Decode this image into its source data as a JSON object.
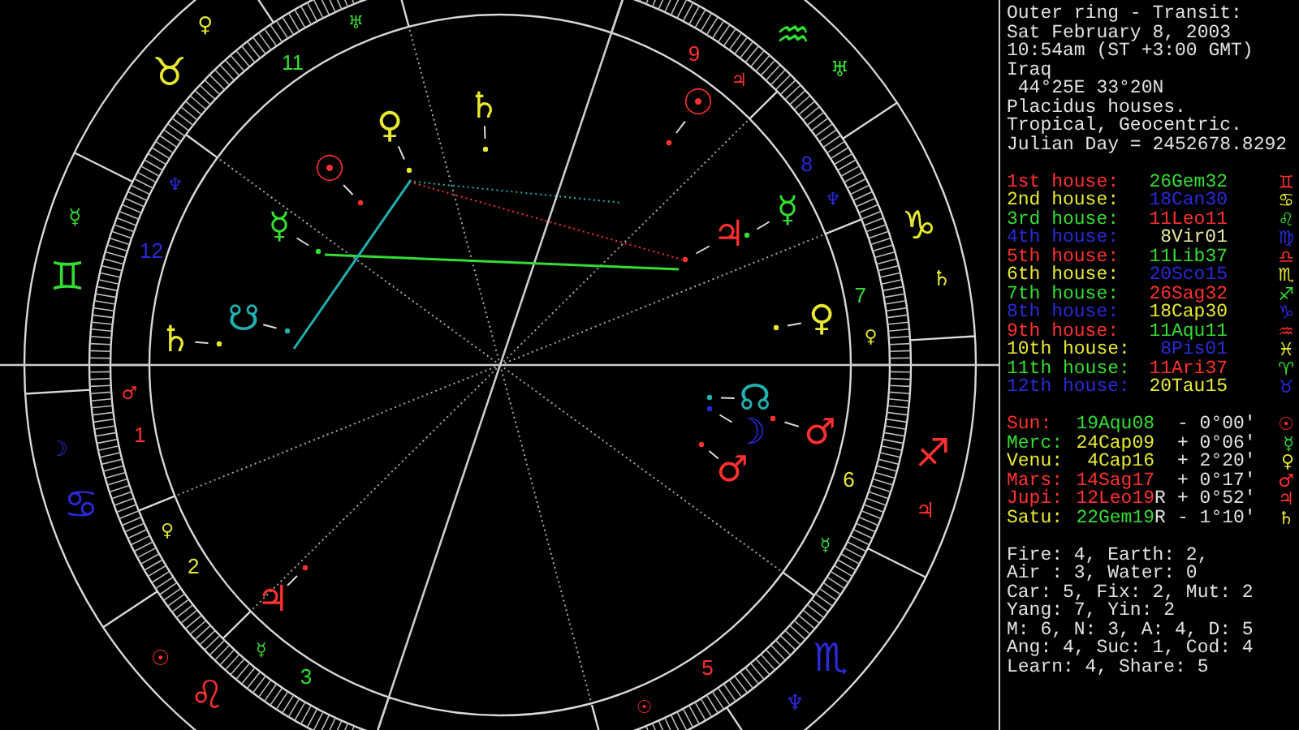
{
  "chart": {
    "signs": [
      {
        "glyph": "♉",
        "color": "#e8e830",
        "ruler": {
          "glyph": "♀",
          "color": "#e8e830"
        }
      },
      {
        "glyph": "♒",
        "color": "#33dd33",
        "ruler": {
          "glyph": "♅",
          "color": "#33dd33"
        }
      },
      {
        "glyph": "♊",
        "color": "#33dd33",
        "ruler": {
          "glyph": "☿",
          "color": "#33dd33"
        }
      },
      {
        "glyph": "♑",
        "color": "#e8e830",
        "ruler": {
          "glyph": "♄",
          "color": "#e8e830"
        }
      },
      {
        "glyph": "♐",
        "color": "#ff3030",
        "ruler": {
          "glyph": "♃",
          "color": "#ff3030"
        }
      },
      {
        "glyph": "♋",
        "color": "#2a2ad8",
        "ruler": {
          "glyph": "☽",
          "color": "#2a2ad8"
        }
      },
      {
        "glyph": "♌",
        "color": "#ff3030",
        "ruler": {
          "glyph": "☉",
          "color": "#ff3030"
        }
      },
      {
        "glyph": "♏",
        "color": "#2a2ad8",
        "ruler": {
          "glyph": "♆",
          "color": "#2a2ad8"
        }
      }
    ],
    "houses": [
      {
        "number": "11",
        "color": "#33dd33",
        "ruler": {
          "glyph": "♅",
          "color": "#33dd33"
        }
      },
      {
        "number": "9",
        "color": "#ff3030",
        "ruler": {
          "glyph": "♃",
          "color": "#ff3030"
        }
      },
      {
        "number": "8",
        "color": "#2a2ad8",
        "ruler": {
          "glyph": "♆",
          "color": "#2a2ad8"
        }
      },
      {
        "number": "12",
        "color": "#2a2ad8",
        "ruler": {
          "glyph": "♆",
          "color": "#2a2ad8"
        }
      },
      {
        "number": "7",
        "color": "#33dd33",
        "ruler": {
          "glyph": "♀",
          "color": "#e8e830"
        }
      },
      {
        "number": "1",
        "color": "#ff3030",
        "ruler": {
          "glyph": "♂",
          "color": "#ff3030"
        }
      },
      {
        "number": "6",
        "color": "#e8e830",
        "ruler": {
          "glyph": "☿",
          "color": "#33dd33"
        }
      },
      {
        "number": "2",
        "color": "#e8e830",
        "ruler": {
          "glyph": "♀",
          "color": "#e8e830"
        }
      },
      {
        "number": "3",
        "color": "#33dd33",
        "ruler": {
          "glyph": "☿",
          "color": "#33dd33"
        }
      },
      {
        "number": "5",
        "color": "#ff3030",
        "ruler": {
          "glyph": "☉",
          "color": "#ff3030"
        }
      }
    ],
    "planets": [
      {
        "glyph": "♀",
        "color": "#e8e830"
      },
      {
        "glyph": "♄",
        "color": "#e8e830"
      },
      {
        "glyph": "☉",
        "color": "#ff3030"
      },
      {
        "glyph": "☉",
        "color": "#ff3030"
      },
      {
        "glyph": "☿",
        "color": "#33dd33"
      },
      {
        "glyph": "♃",
        "color": "#ff3030"
      },
      {
        "glyph": "☿",
        "color": "#33dd33"
      },
      {
        "glyph": "♄",
        "color": "#e8e830"
      },
      {
        "glyph": "☋",
        "color": "#20b0b0"
      },
      {
        "glyph": "♀",
        "color": "#e8e830"
      },
      {
        "glyph": "☊",
        "color": "#20b0b0"
      },
      {
        "glyph": "☽",
        "color": "#2a2ad8"
      },
      {
        "glyph": "♂",
        "color": "#ff3030"
      },
      {
        "glyph": "♂",
        "color": "#ff3030"
      },
      {
        "glyph": "♃",
        "color": "#ff3030"
      }
    ]
  },
  "info_lines": [
    "Outer ring - Transit:",
    "Sat February 8, 2003",
    "10:54am (ST +3:00 GMT)",
    "Iraq",
    " 44°25E 33°20N",
    "Placidus houses.",
    "Tropical, Geocentric.",
    "Julian Day = 2452678.8292"
  ],
  "houses": [
    {
      "label": {
        "text": "1st house:",
        "color": "#ff3030"
      },
      "position": {
        "text": "26Gem32",
        "color": "#33dd33"
      },
      "sign": {
        "glyph": "♊",
        "color": "#ff3030"
      }
    },
    {
      "label": {
        "text": "2nd house:",
        "color": "#e8e830"
      },
      "position": {
        "text": "18Can30",
        "color": "#2a2ad8"
      },
      "sign": {
        "glyph": "♋",
        "color": "#e8e830"
      }
    },
    {
      "label": {
        "text": "3rd house:",
        "color": "#33dd33"
      },
      "position": {
        "text": "11Leo11",
        "color": "#ff3030"
      },
      "sign": {
        "glyph": "♌",
        "color": "#33dd33"
      }
    },
    {
      "label": {
        "text": "4th house:",
        "color": "#2a2ad8"
      },
      "position": {
        "text": "8Vir01",
        "color": "#e8e8a0"
      },
      "sign": {
        "glyph": "♍",
        "color": "#2a2ad8"
      }
    },
    {
      "label": {
        "text": "5th house:",
        "color": "#ff3030"
      },
      "position": {
        "text": "11Lib37",
        "color": "#33dd33"
      },
      "sign": {
        "glyph": "♎",
        "color": "#ff3030"
      }
    },
    {
      "label": {
        "text": "6th house:",
        "color": "#e8e830"
      },
      "position": {
        "text": "20Sco15",
        "color": "#2a2ad8"
      },
      "sign": {
        "glyph": "♏",
        "color": "#e8e830"
      }
    },
    {
      "label": {
        "text": "7th house:",
        "color": "#33dd33"
      },
      "position": {
        "text": "26Sag32",
        "color": "#ff3030"
      },
      "sign": {
        "glyph": "♐",
        "color": "#33dd33"
      }
    },
    {
      "label": {
        "text": "8th house:",
        "color": "#2a2ad8"
      },
      "position": {
        "text": "18Cap30",
        "color": "#e8e830"
      },
      "sign": {
        "glyph": "♑",
        "color": "#2a2ad8"
      }
    },
    {
      "label": {
        "text": "9th house:",
        "color": "#ff3030"
      },
      "position": {
        "text": "11Aqu11",
        "color": "#33dd33"
      },
      "sign": {
        "glyph": "♒",
        "color": "#ff3030"
      }
    },
    {
      "label": {
        "text": "10th house:",
        "color": "#e8e830"
      },
      "position": {
        "text": "8Pis01",
        "color": "#2a2ad8"
      },
      "sign": {
        "glyph": "♓",
        "color": "#e8e830"
      }
    },
    {
      "label": {
        "text": "11th house:",
        "color": "#33dd33"
      },
      "position": {
        "text": "11Ari37",
        "color": "#ff3030"
      },
      "sign": {
        "glyph": "♈",
        "color": "#33dd33"
      }
    },
    {
      "label": {
        "text": "12th house:",
        "color": "#2a2ad8"
      },
      "position": {
        "text": "20Tau15",
        "color": "#e8e830"
      },
      "sign": {
        "glyph": "♉",
        "color": "#2a2ad8"
      }
    }
  ],
  "planets": [
    {
      "label": {
        "text": "Sun:",
        "color": "#ff3030"
      },
      "position": {
        "text": "19Aqu08",
        "color": "#33dd33"
      },
      "offset": "- 0°00'",
      "symbol": {
        "glyph": "☉",
        "color": "#ff3030"
      }
    },
    {
      "label": {
        "text": "Merc:",
        "color": "#33dd33"
      },
      "position": {
        "text": "24Cap09",
        "color": "#e8e830"
      },
      "offset": "+ 0°06'",
      "symbol": {
        "glyph": "☿",
        "color": "#33dd33"
      }
    },
    {
      "label": {
        "text": "Venu:",
        "color": "#e8e830"
      },
      "position": {
        "text": "4Cap16",
        "color": "#e8e830"
      },
      "offset": "+ 2°20'",
      "symbol": {
        "glyph": "♀",
        "color": "#e8e830"
      }
    },
    {
      "label": {
        "text": "Mars:",
        "color": "#ff3030"
      },
      "position": {
        "text": "14Sag17",
        "color": "#ff3030"
      },
      "offset": "+ 0°17'",
      "symbol": {
        "glyph": "♂",
        "color": "#ff3030"
      }
    },
    {
      "label": {
        "text": "Jupi:",
        "color": "#ff3030"
      },
      "position": {
        "text": "12Leo19",
        "color": "#ff3030"
      },
      "retrograde": "R",
      "offset": "+ 0°52'",
      "symbol": {
        "glyph": "♃",
        "color": "#ff3030"
      }
    },
    {
      "label": {
        "text": "Satu:",
        "color": "#e8e830"
      },
      "position": {
        "text": "22Gem19",
        "color": "#33dd33"
      },
      "retrograde": "R",
      "offset": "- 1°10'",
      "symbol": {
        "glyph": "♄",
        "color": "#e8e830"
      }
    }
  ],
  "stats": [
    "Fire: 4, Earth: 2,",
    "Air : 3, Water: 0",
    "Car: 5, Fix: 2, Mut: 2",
    "Yang: 7, Yin: 2",
    "M: 6, N: 3, A: 4, D: 5",
    "Ang: 4, Suc: 1, Cod: 4",
    "Learn: 4, Share: 5"
  ]
}
